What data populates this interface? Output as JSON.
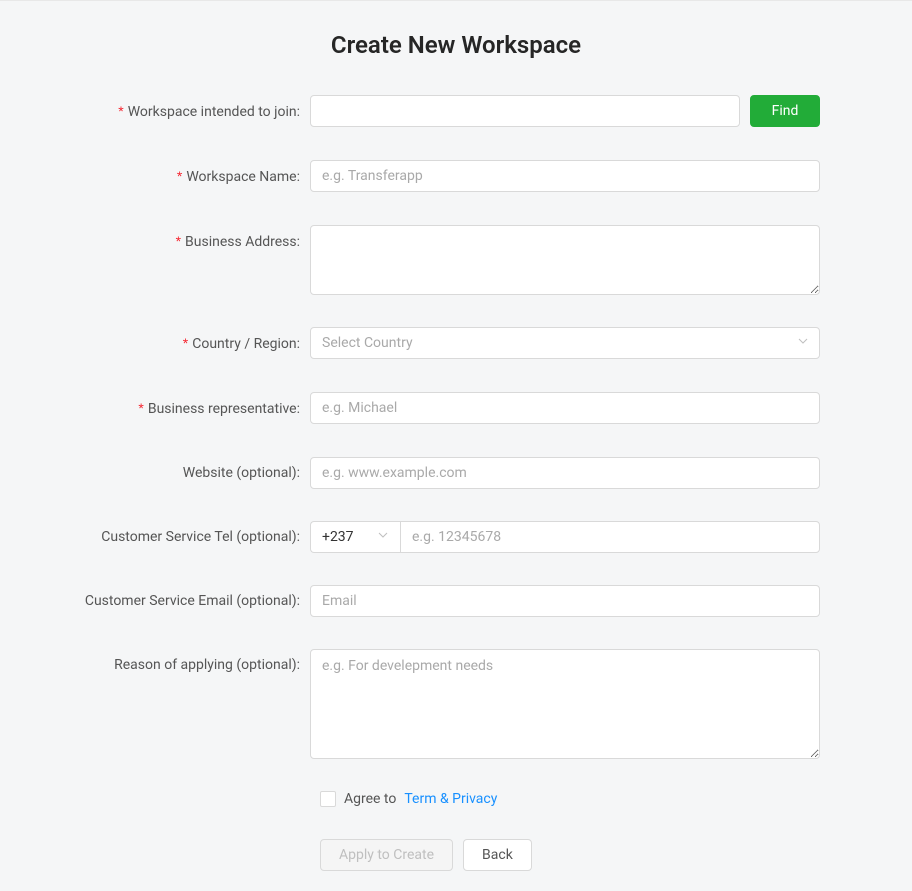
{
  "title": "Create New Workspace",
  "fields": {
    "workspace_join": {
      "label": "Workspace intended to join:",
      "value": "",
      "find_button": "Find"
    },
    "workspace_name": {
      "label": "Workspace Name:",
      "placeholder": "e.g. Transferapp",
      "value": ""
    },
    "business_address": {
      "label": "Business Address:",
      "value": ""
    },
    "country": {
      "label": "Country / Region:",
      "placeholder": "Select Country",
      "value": ""
    },
    "representative": {
      "label": "Business representative:",
      "placeholder": "e.g. Michael",
      "value": ""
    },
    "website": {
      "label": "Website (optional):",
      "placeholder": "e.g. www.example.com",
      "value": ""
    },
    "tel": {
      "label": "Customer Service Tel (optional):",
      "prefix": "+237",
      "placeholder": "e.g. 12345678",
      "value": ""
    },
    "email": {
      "label": "Customer Service Email (optional):",
      "placeholder": "Email",
      "value": ""
    },
    "reason": {
      "label": "Reason of applying (optional):",
      "placeholder": "e.g. For develepment needs",
      "value": ""
    }
  },
  "agree": {
    "text": "Agree to",
    "link": "Term & Privacy"
  },
  "actions": {
    "apply": "Apply to Create",
    "back": "Back"
  }
}
